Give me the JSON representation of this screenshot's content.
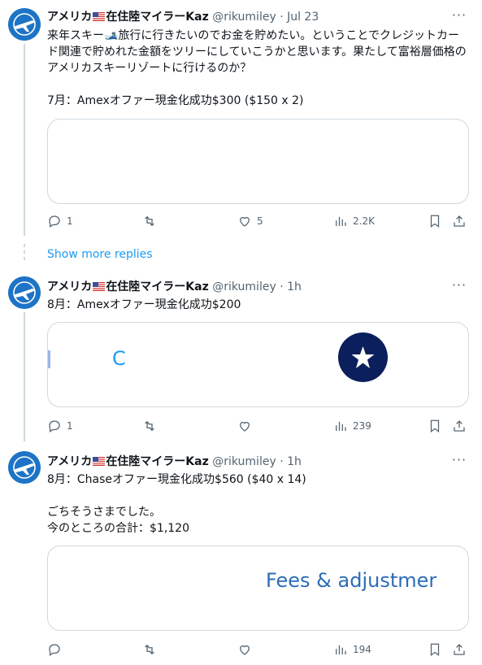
{
  "tweets": [
    {
      "name": "アメリカ🇺🇸在住陸マイラーKaz",
      "name_pre": "アメリカ",
      "name_post": "在住陸マイラーKaz",
      "handle": "@rikumiley",
      "dot": "·",
      "time": "Jul 23",
      "text": "来年スキー🎿旅行に行きたいのでお金を貯めたい。ということでクレジットカード関連で貯めれた金額をツリーにしていこうかと思います。果たして富裕層価格のアメリカスキーリゾートに行けるのか？\n\n7月：Amexオファー現金化成功$300 ($150 x 2)",
      "replies": "1",
      "retweets": "",
      "likes": "5",
      "views": "2.2K"
    },
    {
      "name_pre": "アメリカ",
      "name_post": "在住陸マイラーKaz",
      "handle": "@rikumiley",
      "dot": "·",
      "time": "1h",
      "text": "8月：Amexオファー現金化成功$200",
      "card_letter": "C",
      "replies": "1",
      "retweets": "",
      "likes": "",
      "views": "239"
    },
    {
      "name_pre": "アメリカ",
      "name_post": "在住陸マイラーKaz",
      "handle": "@rikumiley",
      "dot": "·",
      "time": "1h",
      "text": "8月：Chaseオファー現金化成功$560 ($40 x 14)\n\nごちそうさまでした。\n今のところの合計：$1,120",
      "card_text": "Fees & adjustmer",
      "replies": "",
      "retweets": "",
      "likes": "",
      "views": "194"
    }
  ],
  "show_more": "Show more replies",
  "more_glyph": "···",
  "colors": {
    "accent": "#1d9bf0",
    "muted": "#536471",
    "border": "#cfd9de",
    "avatar": "#1d74c6"
  }
}
